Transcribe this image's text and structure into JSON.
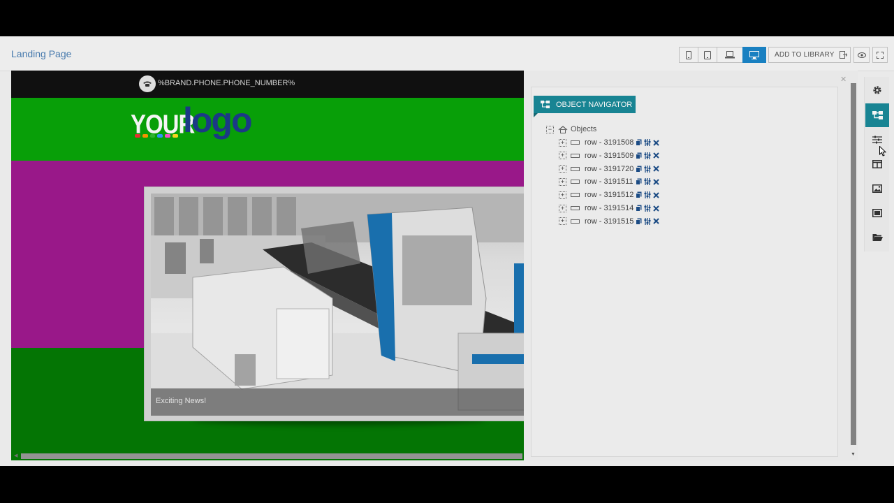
{
  "header": {
    "page_title": "Landing Page",
    "add_to_library_label": "ADD TO LIBRARY"
  },
  "device_buttons": [
    {
      "name": "mobile",
      "icon": "mobile-icon",
      "active": false
    },
    {
      "name": "tablet",
      "icon": "tablet-icon",
      "active": false
    },
    {
      "name": "laptop",
      "icon": "laptop-icon",
      "active": false
    },
    {
      "name": "desktop",
      "icon": "desktop-icon",
      "active": true
    }
  ],
  "canvas": {
    "phone_text": "%BRAND.PHONE.PHONE_NUMBER%",
    "logo_your": "YOUR",
    "logo_logo": "logo",
    "caption": "Exciting News!"
  },
  "navigator": {
    "button_label": "OBJECT NAVIGATOR",
    "root_label": "Objects",
    "rows": [
      {
        "label": "row - 3191508"
      },
      {
        "label": "row - 3191509"
      },
      {
        "label": "row - 3191720"
      },
      {
        "label": "row - 3191511"
      },
      {
        "label": "row - 3191512"
      },
      {
        "label": "row - 3191514"
      },
      {
        "label": "row - 3191515"
      }
    ]
  },
  "colors": {
    "accent": "#1a8a99",
    "active_device": "#1b86c9",
    "green": "#09a609",
    "magenta": "#a0198f"
  }
}
